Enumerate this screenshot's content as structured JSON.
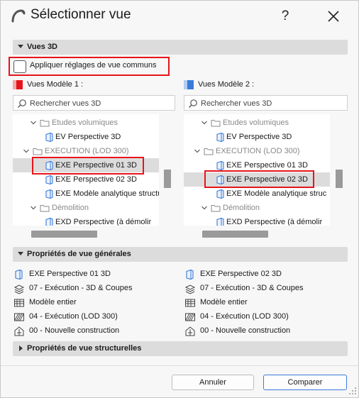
{
  "window": {
    "title": "Sélectionner vue",
    "help": "?"
  },
  "sections": {
    "views3d": "Vues 3D",
    "general": "Propriétés de vue générales",
    "structural": "Propriétés de vue structurelles"
  },
  "common_settings": {
    "label": "Appliquer réglages de vue communs",
    "checked": false
  },
  "model1": {
    "label": "Vues Modèle 1 :",
    "color": "#e8141b",
    "search_placeholder": "Rechercher vues 3D",
    "tree": [
      {
        "label": "Etudes volumiques",
        "type": "folder"
      },
      {
        "label": "EV Perspective 3D",
        "type": "view"
      },
      {
        "label": "EXECUTION (LOD 300)",
        "type": "folder"
      },
      {
        "label": "EXE Perspective 01 3D",
        "type": "view",
        "selected": true
      },
      {
        "label": "EXE Perspective 02 3D",
        "type": "view"
      },
      {
        "label": "EXE Modèle analytique structu",
        "type": "view"
      },
      {
        "label": "Démolition",
        "type": "folder"
      },
      {
        "label": "EXD Perspective (à démolir",
        "type": "view"
      }
    ]
  },
  "model2": {
    "label": "Vues Modèle 2 :",
    "color": "#3b7bd9",
    "search_placeholder": "Rechercher vues 3D",
    "tree": [
      {
        "label": "Etudes volumiques",
        "type": "folder"
      },
      {
        "label": "EV Perspective 3D",
        "type": "view"
      },
      {
        "label": "EXECUTION (LOD 300)",
        "type": "folder"
      },
      {
        "label": "EXE Perspective 01 3D",
        "type": "view"
      },
      {
        "label": "EXE Perspective 02 3D",
        "type": "view",
        "selected": true
      },
      {
        "label": "EXE Modèle analytique struc",
        "type": "view"
      },
      {
        "label": "Démolition",
        "type": "folder"
      },
      {
        "label": "EXD Perspective (à démolir",
        "type": "view"
      }
    ]
  },
  "general_props": {
    "left": [
      {
        "icon": "view-3d-icon",
        "text": "EXE Perspective 01 3D"
      },
      {
        "icon": "layers-icon",
        "text": "07 - Exécution - 3D & Coupes"
      },
      {
        "icon": "model-filter-icon",
        "text": "Modèle entier"
      },
      {
        "icon": "structure-icon",
        "text": "04 - Exécution (LOD 300)"
      },
      {
        "icon": "renovation-icon",
        "text": "00 - Nouvelle construction"
      }
    ],
    "right": [
      {
        "icon": "view-3d-icon",
        "text": "EXE Perspective 02 3D"
      },
      {
        "icon": "layers-icon",
        "text": "07 - Exécution - 3D & Coupes"
      },
      {
        "icon": "model-filter-icon",
        "text": "Modèle entier"
      },
      {
        "icon": "structure-icon",
        "text": "04 - Exécution (LOD 300)"
      },
      {
        "icon": "renovation-icon",
        "text": "00 - Nouvelle construction"
      }
    ]
  },
  "buttons": {
    "cancel": "Annuler",
    "compare": "Comparer"
  }
}
